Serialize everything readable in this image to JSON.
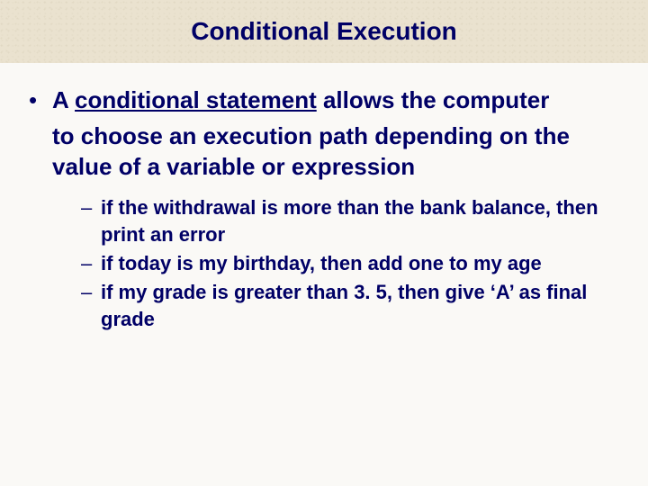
{
  "title": "Conditional Execution",
  "main": {
    "line1_prefix": "A ",
    "line1_underlined": "conditional statement",
    "line1_suffix": " allows the computer",
    "line2": "to choose an execution path depending on the value of a variable or expression"
  },
  "subs": [
    " if the withdrawal is more than the bank balance, then print an error",
    "if today is my birthday, then add one to my age",
    "if my grade is greater than 3. 5, then give ‘A’ as final grade"
  ]
}
